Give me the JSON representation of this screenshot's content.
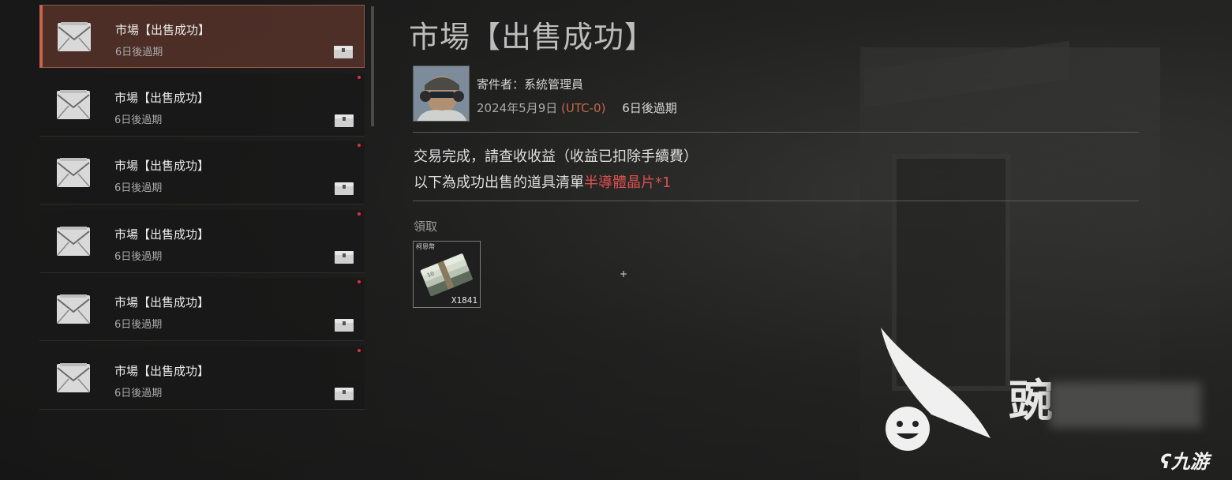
{
  "mail_list": {
    "items": [
      {
        "title": "市場【出售成功】",
        "expiry": "6日後過期",
        "selected": true,
        "unread": false
      },
      {
        "title": "市場【出售成功】",
        "expiry": "6日後過期",
        "selected": false,
        "unread": true
      },
      {
        "title": "市場【出售成功】",
        "expiry": "6日後過期",
        "selected": false,
        "unread": true
      },
      {
        "title": "市場【出售成功】",
        "expiry": "6日後過期",
        "selected": false,
        "unread": true
      },
      {
        "title": "市場【出售成功】",
        "expiry": "6日後過期",
        "selected": false,
        "unread": true
      },
      {
        "title": "市場【出售成功】",
        "expiry": "6日後過期",
        "selected": false,
        "unread": true
      }
    ],
    "item_icon": "envelope-icon",
    "attachment_icon": "chest-icon"
  },
  "detail": {
    "title": "市場【出售成功】",
    "sender": "寄件者：系統管理員",
    "date": "2024年5月9日",
    "timezone": "(UTC-0)",
    "expiry": "6日後過期",
    "body_line1": "交易完成，請查收收益（收益已扣除手續費）",
    "body_line2_prefix": "以下為成功出售的道具清單",
    "body_line2_highlight": "半導體晶片*1",
    "claim_label": "領取",
    "reward": {
      "name": "柯恩幣",
      "quantity": "X1841",
      "icon": "money-stack-icon"
    }
  },
  "watermark": {
    "text": "豌",
    "site": "九游"
  },
  "colors": {
    "accent": "#c5654a",
    "highlight": "#d9504e",
    "unread_dot": "#e0303a"
  }
}
